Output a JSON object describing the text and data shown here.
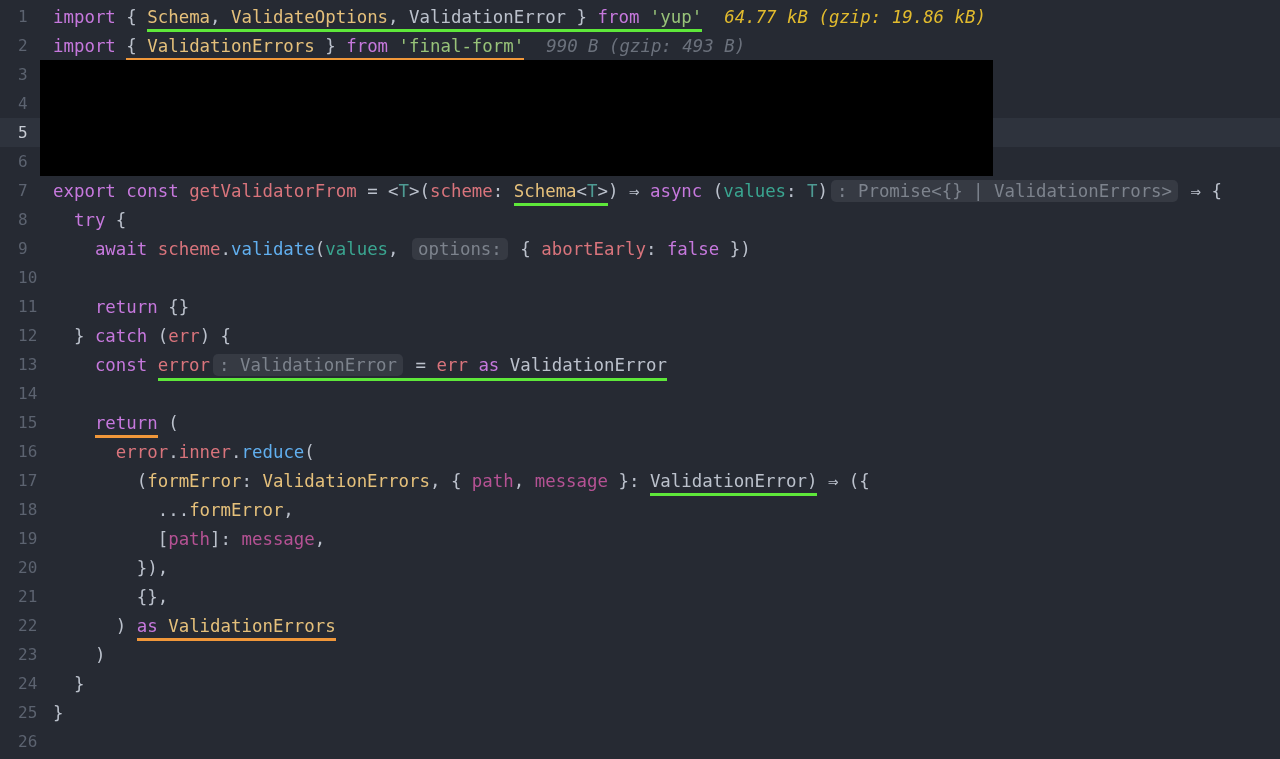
{
  "editor": {
    "lines": [
      {
        "number": "1",
        "current": false,
        "redacted": false,
        "tokens": [
          {
            "text": "import",
            "kind": "kw"
          },
          {
            "text": " { ",
            "kind": "plain"
          },
          {
            "kind": "underline",
            "color": "#5ee83a",
            "tokens": [
              {
                "text": "Schema",
                "kind": "type"
              },
              {
                "text": ", ",
                "kind": "plain"
              },
              {
                "text": "ValidateOptions",
                "kind": "type"
              },
              {
                "text": ", ValidationError } ",
                "kind": "plain"
              },
              {
                "text": "from ",
                "kind": "kw"
              },
              {
                "text": "'yup'",
                "kind": "str"
              }
            ]
          },
          {
            "text": "64.77 kB (gzip: 19.86 kB)",
            "kind": "size"
          }
        ]
      },
      {
        "number": "2",
        "current": false,
        "redacted": false,
        "tokens": [
          {
            "text": "import ",
            "kind": "kw"
          },
          {
            "kind": "underline",
            "color": "#f0973a",
            "tokens": [
              {
                "text": "{ ",
                "kind": "plain"
              },
              {
                "text": "ValidationErrors",
                "kind": "type"
              },
              {
                "text": " } ",
                "kind": "plain"
              },
              {
                "text": "from ",
                "kind": "kw"
              },
              {
                "text": "'final-form'",
                "kind": "str"
              }
            ]
          },
          {
            "text": "990 B (gzip: 493 B)",
            "kind": "meta"
          }
        ]
      },
      {
        "number": "3",
        "current": false,
        "redacted": true
      },
      {
        "number": "4",
        "current": false,
        "redacted": true
      },
      {
        "number": "5",
        "current": true,
        "redacted": true
      },
      {
        "number": "6",
        "current": false,
        "redacted": true
      },
      {
        "number": "7",
        "current": false,
        "redacted": false,
        "tokens": [
          {
            "text": "export ",
            "kind": "kw"
          },
          {
            "text": "const ",
            "kind": "kw"
          },
          {
            "text": "getValidatorFrom",
            "kind": "var"
          },
          {
            "text": " = <",
            "kind": "plain"
          },
          {
            "text": "T",
            "kind": "tparam"
          },
          {
            "text": ">(",
            "kind": "plain"
          },
          {
            "text": "scheme",
            "kind": "var"
          },
          {
            "text": ": ",
            "kind": "plain"
          },
          {
            "kind": "underline",
            "color": "#5ee83a",
            "tokens": [
              {
                "text": "Schema",
                "kind": "type"
              },
              {
                "text": "<",
                "kind": "plain"
              },
              {
                "text": "T",
                "kind": "tparam"
              },
              {
                "text": ">",
                "kind": "plain"
              }
            ]
          },
          {
            "text": ") ⇒ ",
            "kind": "plain"
          },
          {
            "text": "async",
            "kind": "kw"
          },
          {
            "text": " (",
            "kind": "plain"
          },
          {
            "text": "values",
            "kind": "param"
          },
          {
            "text": ": ",
            "kind": "plain"
          },
          {
            "text": "T",
            "kind": "tparam"
          },
          {
            "text": ")",
            "kind": "plain"
          },
          {
            "text": ": Promise<{} | ValidationErrors>",
            "kind": "hint"
          },
          {
            "text": " ⇒ {",
            "kind": "plain"
          }
        ]
      },
      {
        "number": "8",
        "current": false,
        "redacted": false,
        "tokens": [
          {
            "text": "  try",
            "kind": "kw"
          },
          {
            "text": " {",
            "kind": "plain"
          }
        ]
      },
      {
        "number": "9",
        "current": false,
        "redacted": false,
        "tokens": [
          {
            "text": "    await ",
            "kind": "kw"
          },
          {
            "text": "scheme",
            "kind": "var"
          },
          {
            "text": ".",
            "kind": "plain"
          },
          {
            "text": "validate",
            "kind": "fn"
          },
          {
            "text": "(",
            "kind": "plain"
          },
          {
            "text": "values",
            "kind": "param"
          },
          {
            "text": ", ",
            "kind": "plain"
          },
          {
            "text": "options:",
            "kind": "hint"
          },
          {
            "text": " { ",
            "kind": "plain"
          },
          {
            "text": "abortEarly",
            "kind": "var"
          },
          {
            "text": ": ",
            "kind": "plain"
          },
          {
            "text": "false",
            "kind": "kw"
          },
          {
            "text": " })",
            "kind": "plain"
          }
        ]
      },
      {
        "number": "10",
        "current": false,
        "redacted": false
      },
      {
        "number": "11",
        "current": false,
        "redacted": false,
        "tokens": [
          {
            "text": "    return",
            "kind": "kw"
          },
          {
            "text": " {}",
            "kind": "plain"
          }
        ]
      },
      {
        "number": "12",
        "current": false,
        "redacted": false,
        "tokens": [
          {
            "text": "  } ",
            "kind": "plain"
          },
          {
            "text": "catch",
            "kind": "kw"
          },
          {
            "text": " (",
            "kind": "plain"
          },
          {
            "text": "err",
            "kind": "var"
          },
          {
            "text": ") {",
            "kind": "plain"
          }
        ]
      },
      {
        "number": "13",
        "current": false,
        "redacted": false,
        "tokens": [
          {
            "text": "    const ",
            "kind": "kw"
          },
          {
            "kind": "underline",
            "color": "#5ee83a",
            "tokens": [
              {
                "text": "error",
                "kind": "var"
              },
              {
                "text": ": ValidationError",
                "kind": "hint"
              },
              {
                "text": " = ",
                "kind": "plain"
              },
              {
                "text": "err ",
                "kind": "var"
              },
              {
                "text": "as",
                "kind": "kw"
              },
              {
                "text": " ValidationError",
                "kind": "plain"
              }
            ]
          }
        ]
      },
      {
        "number": "14",
        "current": false,
        "redacted": false
      },
      {
        "number": "15",
        "current": false,
        "redacted": false,
        "tokens": [
          {
            "kind": "underline",
            "color": "#f0973a",
            "tokens": [
              {
                "text": "    return",
                "kind": "kw"
              }
            ]
          },
          {
            "text": " (",
            "kind": "plain"
          }
        ]
      },
      {
        "number": "16",
        "current": false,
        "redacted": false,
        "tokens": [
          {
            "text": "      error",
            "kind": "var"
          },
          {
            "text": ".",
            "kind": "plain"
          },
          {
            "text": "inner",
            "kind": "var"
          },
          {
            "text": ".",
            "kind": "plain"
          },
          {
            "text": "reduce",
            "kind": "fn"
          },
          {
            "text": "(",
            "kind": "plain"
          }
        ]
      },
      {
        "number": "17",
        "current": false,
        "redacted": false,
        "tokens": [
          {
            "text": "        (",
            "kind": "plain"
          },
          {
            "text": "formError",
            "kind": "type"
          },
          {
            "text": ": ",
            "kind": "plain"
          },
          {
            "text": "ValidationErrors",
            "kind": "type"
          },
          {
            "text": ", { ",
            "kind": "plain"
          },
          {
            "text": "path",
            "kind": "prop"
          },
          {
            "text": ", ",
            "kind": "plain"
          },
          {
            "text": "message",
            "kind": "prop"
          },
          {
            "text": " }: ",
            "kind": "plain"
          },
          {
            "kind": "underline",
            "color": "#5ee83a",
            "tokens": [
              {
                "text": "ValidationError)",
                "kind": "plain"
              }
            ]
          },
          {
            "text": " ⇒ ({",
            "kind": "plain"
          }
        ]
      },
      {
        "number": "18",
        "current": false,
        "redacted": false,
        "tokens": [
          {
            "text": "          ...",
            "kind": "plain"
          },
          {
            "text": "formError",
            "kind": "type"
          },
          {
            "text": ",",
            "kind": "plain"
          }
        ]
      },
      {
        "number": "19",
        "current": false,
        "redacted": false,
        "tokens": [
          {
            "text": "          [",
            "kind": "plain"
          },
          {
            "text": "path",
            "kind": "prop"
          },
          {
            "text": "]: ",
            "kind": "plain"
          },
          {
            "text": "message",
            "kind": "prop"
          },
          {
            "text": ",",
            "kind": "plain"
          }
        ]
      },
      {
        "number": "20",
        "current": false,
        "redacted": false,
        "tokens": [
          {
            "text": "        }),",
            "kind": "plain"
          }
        ]
      },
      {
        "number": "21",
        "current": false,
        "redacted": false,
        "tokens": [
          {
            "text": "        {},",
            "kind": "plain"
          }
        ]
      },
      {
        "number": "22",
        "current": false,
        "redacted": false,
        "tokens": [
          {
            "text": "      ) ",
            "kind": "plain"
          },
          {
            "kind": "underline",
            "color": "#f0973a",
            "tokens": [
              {
                "text": "as ",
                "kind": "kw"
              },
              {
                "text": "ValidationErrors",
                "kind": "type"
              }
            ]
          }
        ]
      },
      {
        "number": "23",
        "current": false,
        "redacted": false,
        "tokens": [
          {
            "text": "    )",
            "kind": "plain"
          }
        ]
      },
      {
        "number": "24",
        "current": false,
        "redacted": false,
        "tokens": [
          {
            "text": "  }",
            "kind": "plain"
          }
        ]
      },
      {
        "number": "25",
        "current": false,
        "redacted": false,
        "tokens": [
          {
            "text": "}",
            "kind": "plain"
          }
        ]
      },
      {
        "number": "26",
        "current": false,
        "redacted": false
      }
    ]
  }
}
